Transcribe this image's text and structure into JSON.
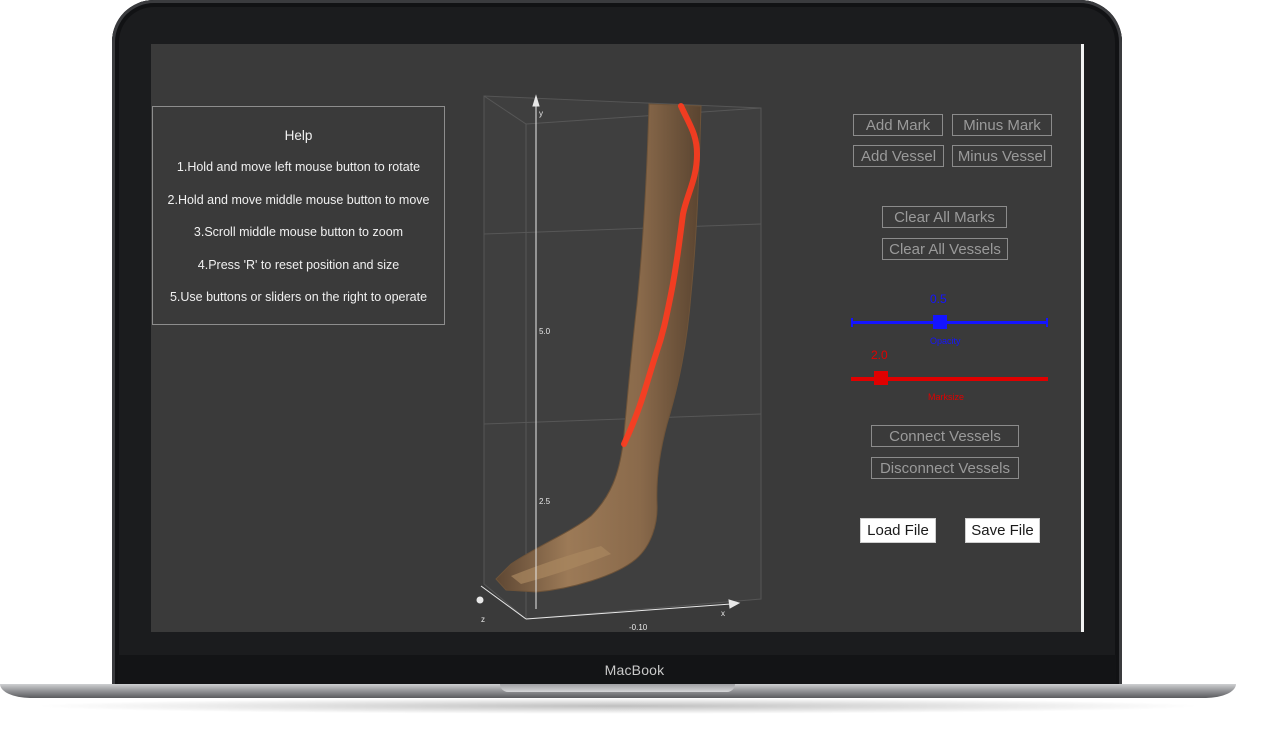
{
  "device": {
    "brand_label": "MacBook"
  },
  "help": {
    "title": "Help",
    "lines": [
      "1.Hold and move left mouse button to rotate",
      "2.Hold and move middle mouse button to move",
      "3.Scroll middle mouse button to zoom",
      "4.Press 'R' to reset position and size",
      "5.Use buttons or sliders on the right to operate"
    ]
  },
  "viewer": {
    "axis_labels": {
      "y": "y",
      "x": "x",
      "z": "z"
    },
    "tick_labels": {
      "y_mid": "5.0",
      "y_low": "2.5",
      "x_mid": "-0.10"
    }
  },
  "controls": {
    "add_mark": "Add Mark",
    "minus_mark": "Minus Mark",
    "add_vessel": "Add Vessel",
    "minus_vessel": "Minus Vessel",
    "clear_all_marks": "Clear All Marks",
    "clear_all_vessels": "Clear All Vessels",
    "connect_vessels": "Connect Vessels",
    "disconnect_vessels": "Disconnect Vessels",
    "load_file": "Load File",
    "save_file": "Save File"
  },
  "sliders": {
    "opacity": {
      "value_text": "0.5",
      "label": "Opacity",
      "fraction": 0.45,
      "color": "#1414ff"
    },
    "marksize": {
      "value_text": "2.0",
      "label": "Marksize",
      "fraction": 0.15,
      "color": "#e00000"
    }
  },
  "colors": {
    "screen_bg": "#3a3a3a",
    "vessel": "#ff3b1f",
    "leg": "#8b6a4a"
  }
}
